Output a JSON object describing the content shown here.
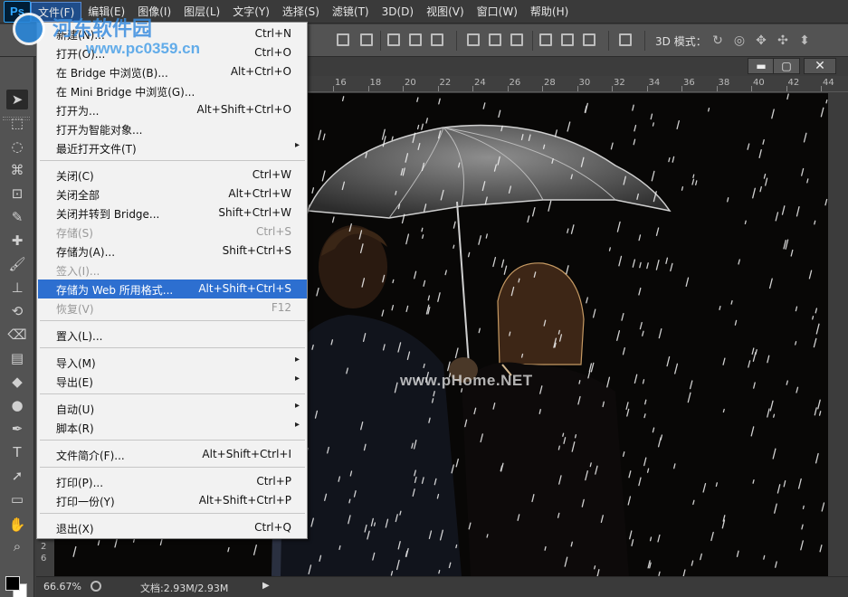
{
  "app": {
    "logo": "Ps",
    "menus": [
      "文件(F)",
      "编辑(E)",
      "图像(I)",
      "图层(L)",
      "文字(Y)",
      "选择(S)",
      "滤镜(T)",
      "3D(D)",
      "视图(V)",
      "窗口(W)",
      "帮助(H)"
    ]
  },
  "options": {
    "mode_label": "3D 模式："
  },
  "document": {
    "ruler_h": [
      "16",
      "18",
      "20",
      "22",
      "24",
      "26",
      "28",
      "30",
      "32",
      "34",
      "36",
      "38",
      "40",
      "42",
      "44"
    ],
    "ruler_v": [
      "2",
      "6"
    ],
    "watermark": "www.pHome.NET",
    "window_buttons": {
      "minimize": "▬",
      "restore": "▢",
      "close": "✕"
    }
  },
  "status": {
    "zoom": "66.67%",
    "doc_info": "文档:2.93M/2.93M",
    "arrow": "▶"
  },
  "site_overlay": {
    "name": "河东软件园",
    "url": "www.pc0359.cn"
  },
  "file_menu": {
    "items": [
      {
        "label": "新建(N)...",
        "shortcut": "Ctrl+N"
      },
      {
        "label": "打开(O)...",
        "shortcut": "Ctrl+O"
      },
      {
        "label": "在 Bridge 中浏览(B)...",
        "shortcut": "Alt+Ctrl+O"
      },
      {
        "label": "在 Mini Bridge 中浏览(G)...",
        "shortcut": ""
      },
      {
        "label": "打开为...",
        "shortcut": "Alt+Shift+Ctrl+O"
      },
      {
        "label": "打开为智能对象...",
        "shortcut": ""
      },
      {
        "label": "最近打开文件(T)",
        "shortcut": "",
        "submenu": true
      },
      {
        "label": "关闭(C)",
        "shortcut": "Ctrl+W"
      },
      {
        "label": "关闭全部",
        "shortcut": "Alt+Ctrl+W"
      },
      {
        "label": "关闭并转到 Bridge...",
        "shortcut": "Shift+Ctrl+W"
      },
      {
        "label": "存储(S)",
        "shortcut": "Ctrl+S",
        "disabled": true
      },
      {
        "label": "存储为(A)...",
        "shortcut": "Shift+Ctrl+S"
      },
      {
        "label": "签入(I)...",
        "shortcut": "",
        "disabled": true
      },
      {
        "label": "存储为 Web 所用格式...",
        "shortcut": "Alt+Shift+Ctrl+S",
        "highlighted": true
      },
      {
        "label": "恢复(V)",
        "shortcut": "F12",
        "disabled": true
      },
      {
        "label": "置入(L)...",
        "shortcut": ""
      },
      {
        "label": "导入(M)",
        "shortcut": "",
        "submenu": true
      },
      {
        "label": "导出(E)",
        "shortcut": "",
        "submenu": true
      },
      {
        "label": "自动(U)",
        "shortcut": "",
        "submenu": true
      },
      {
        "label": "脚本(R)",
        "shortcut": "",
        "submenu": true
      },
      {
        "label": "文件简介(F)...",
        "shortcut": "Alt+Shift+Ctrl+I"
      },
      {
        "label": "打印(P)...",
        "shortcut": "Ctrl+P"
      },
      {
        "label": "打印一份(Y)",
        "shortcut": "Alt+Shift+Ctrl+P"
      },
      {
        "label": "退出(X)",
        "shortcut": "Ctrl+Q"
      }
    ],
    "submenu_arrow": "▸"
  },
  "tools": [
    "move-tool",
    "marquee-tool",
    "lasso-tool",
    "quick-selection-tool",
    "crop-tool",
    "eyedropper-tool",
    "healing-brush-tool",
    "brush-tool",
    "clone-stamp-tool",
    "history-brush-tool",
    "eraser-tool",
    "gradient-tool",
    "blur-tool",
    "dodge-tool",
    "pen-tool",
    "type-tool",
    "path-selection-tool",
    "shape-tool",
    "hand-tool",
    "zoom-tool"
  ],
  "colors": {
    "menu_highlight": "#2d6fd0",
    "ui_dark": "#535353",
    "photo_bg": "#080706"
  }
}
